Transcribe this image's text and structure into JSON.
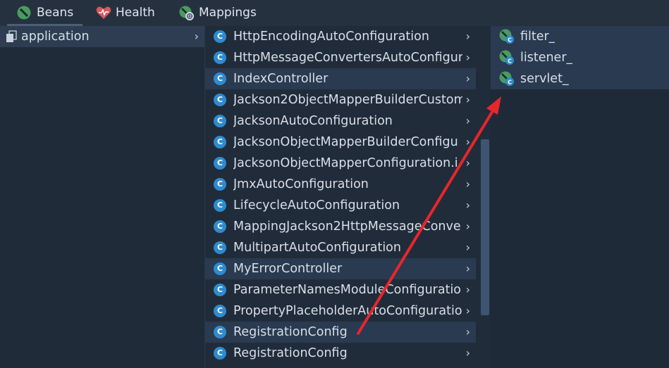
{
  "tabs": [
    {
      "label": "Beans",
      "icon": "bean-icon"
    },
    {
      "label": "Health",
      "icon": "heart-icon"
    },
    {
      "label": "Mappings",
      "icon": "mapping-icon"
    }
  ],
  "column1": {
    "items": [
      {
        "label": "application",
        "icon": "stack-icon",
        "chevron": "›"
      }
    ]
  },
  "column2": {
    "items": [
      {
        "label": "HttpEncodingAutoConfiguration"
      },
      {
        "label": "HttpMessageConvertersAutoConfigur"
      },
      {
        "label": "IndexController"
      },
      {
        "label": "Jackson2ObjectMapperBuilderCustom"
      },
      {
        "label": "JacksonAutoConfiguration"
      },
      {
        "label": "JacksonObjectMapperBuilderConfigu"
      },
      {
        "label": "JacksonObjectMapperConfiguration.i"
      },
      {
        "label": "JmxAutoConfiguration"
      },
      {
        "label": "LifecycleAutoConfiguration"
      },
      {
        "label": "MappingJackson2HttpMessageConve"
      },
      {
        "label": "MultipartAutoConfiguration"
      },
      {
        "label": "MyErrorController"
      },
      {
        "label": "ParameterNamesModuleConfiguratio"
      },
      {
        "label": "PropertyPlaceholderAutoConfiguratio"
      },
      {
        "label": "RegistrationConfig"
      },
      {
        "label": "RegistrationConfig"
      }
    ],
    "chevron": "›"
  },
  "column3": {
    "items": [
      {
        "label": "filter_"
      },
      {
        "label": "listener_"
      },
      {
        "label": "servlet_"
      }
    ]
  },
  "colors": {
    "background": "#1e2a3a",
    "class_icon": "#2e8bd0",
    "bean_icon": "#4a9b5f",
    "arrow": "#e8262b"
  }
}
